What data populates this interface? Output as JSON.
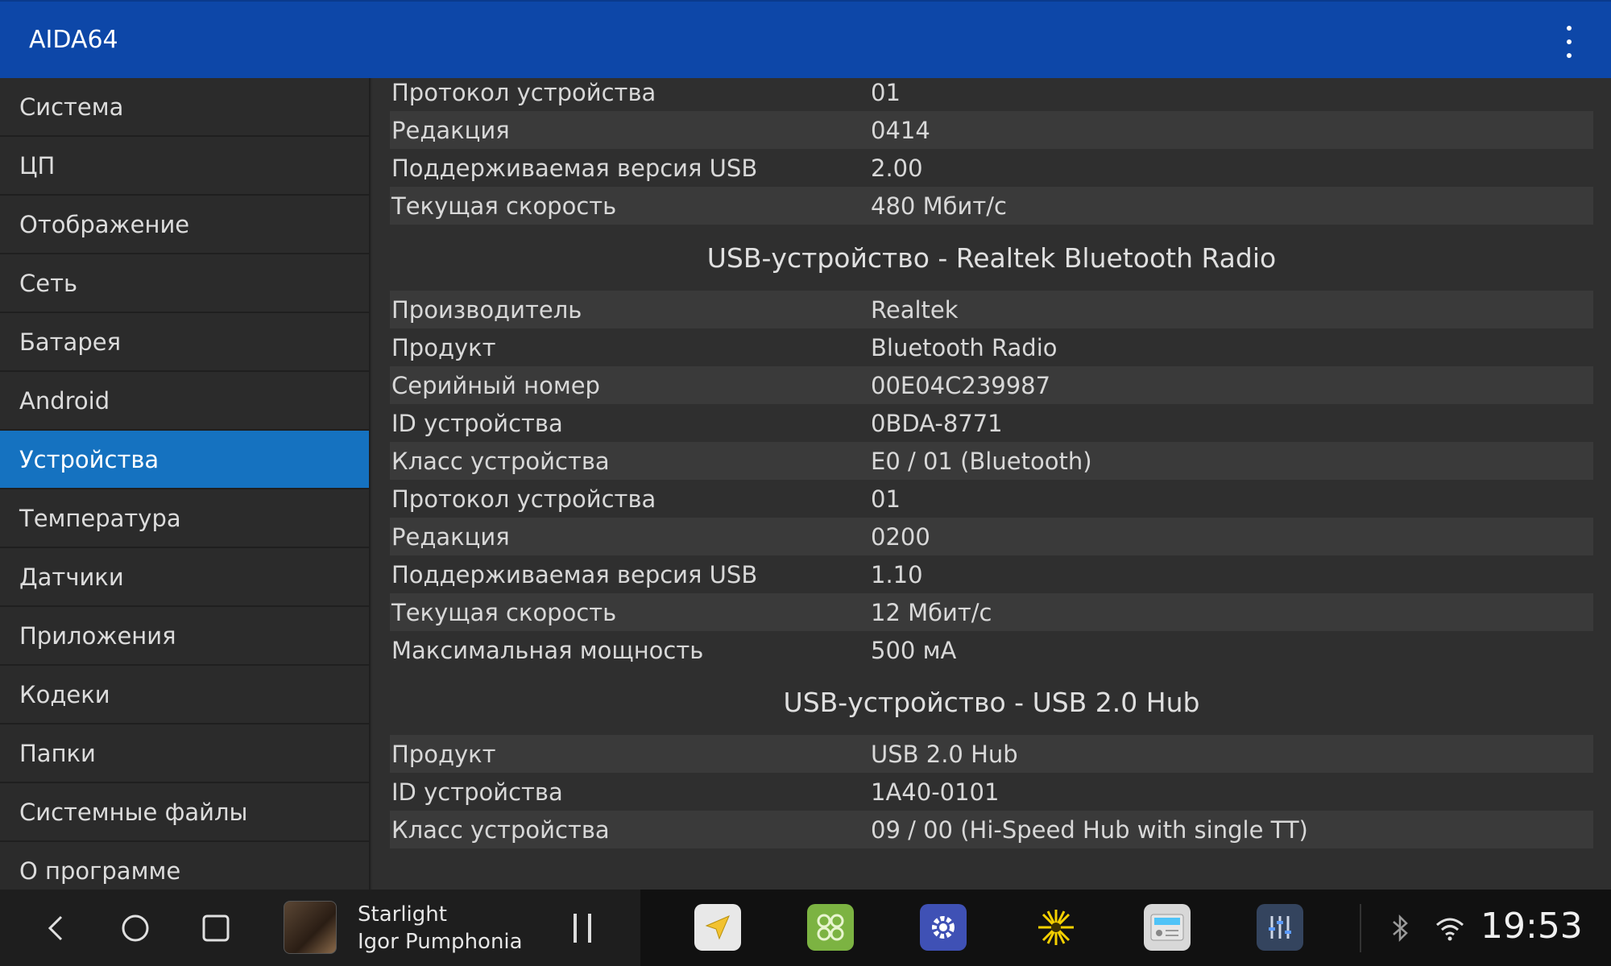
{
  "appbar": {
    "title": "AIDA64"
  },
  "sidebar": {
    "items": [
      {
        "label": "Система"
      },
      {
        "label": "ЦП"
      },
      {
        "label": "Отображение"
      },
      {
        "label": "Сеть"
      },
      {
        "label": "Батарея"
      },
      {
        "label": "Android"
      },
      {
        "label": "Устройства",
        "active": true
      },
      {
        "label": "Температура"
      },
      {
        "label": "Датчики"
      },
      {
        "label": "Приложения"
      },
      {
        "label": "Кодеки"
      },
      {
        "label": "Папки"
      },
      {
        "label": "Системные файлы"
      },
      {
        "label": "О программе"
      }
    ]
  },
  "content": {
    "previous_rows": [
      {
        "key": "Протокол устройства",
        "value": "01"
      },
      {
        "key": "Редакция",
        "value": "0414"
      },
      {
        "key": "Поддерживаемая версия USB",
        "value": "2.00"
      },
      {
        "key": "Текущая скорость",
        "value": "480 Мбит/с"
      }
    ],
    "sections": [
      {
        "title": "USB-устройство - Realtek Bluetooth Radio",
        "rows": [
          {
            "key": "Производитель",
            "value": "Realtek"
          },
          {
            "key": "Продукт",
            "value": "Bluetooth Radio"
          },
          {
            "key": "Серийный номер",
            "value": "00E04C239987"
          },
          {
            "key": "ID устройства",
            "value": "0BDA-8771"
          },
          {
            "key": "Класс устройства",
            "value": "E0 / 01 (Bluetooth)"
          },
          {
            "key": "Протокол устройства",
            "value": "01"
          },
          {
            "key": "Редакция",
            "value": "0200"
          },
          {
            "key": "Поддерживаемая версия USB",
            "value": "1.10"
          },
          {
            "key": "Текущая скорость",
            "value": "12 Мбит/с"
          },
          {
            "key": "Максимальная мощность",
            "value": "500 мА"
          }
        ]
      },
      {
        "title": "USB-устройство - USB 2.0 Hub",
        "rows": [
          {
            "key": "Продукт",
            "value": "USB 2.0 Hub"
          },
          {
            "key": "ID устройства",
            "value": "1A40-0101"
          },
          {
            "key": "Класс устройства",
            "value": "09 / 00 (Hi-Speed Hub with single TT)"
          }
        ]
      }
    ]
  },
  "navbar": {
    "media": {
      "title": "Starlight",
      "artist": "Igor Pumphonia"
    },
    "apps": [
      {
        "icon": "navigation-icon",
        "color": "#f2c230"
      },
      {
        "icon": "apps-grid-icon",
        "color": "#7cb342"
      },
      {
        "icon": "settings-gear-icon",
        "color": "#3f51b5"
      },
      {
        "icon": "sun-burst-icon",
        "color": "#f5d000"
      },
      {
        "icon": "radio-icon",
        "color": "#4fc3f7"
      },
      {
        "icon": "equalizer-icon",
        "color": "#5c7bbd"
      }
    ],
    "clock": "19:53"
  },
  "colors": {
    "appbar": "#0d47a8",
    "active_item": "#1572c0",
    "background": "#2b2b2b"
  }
}
